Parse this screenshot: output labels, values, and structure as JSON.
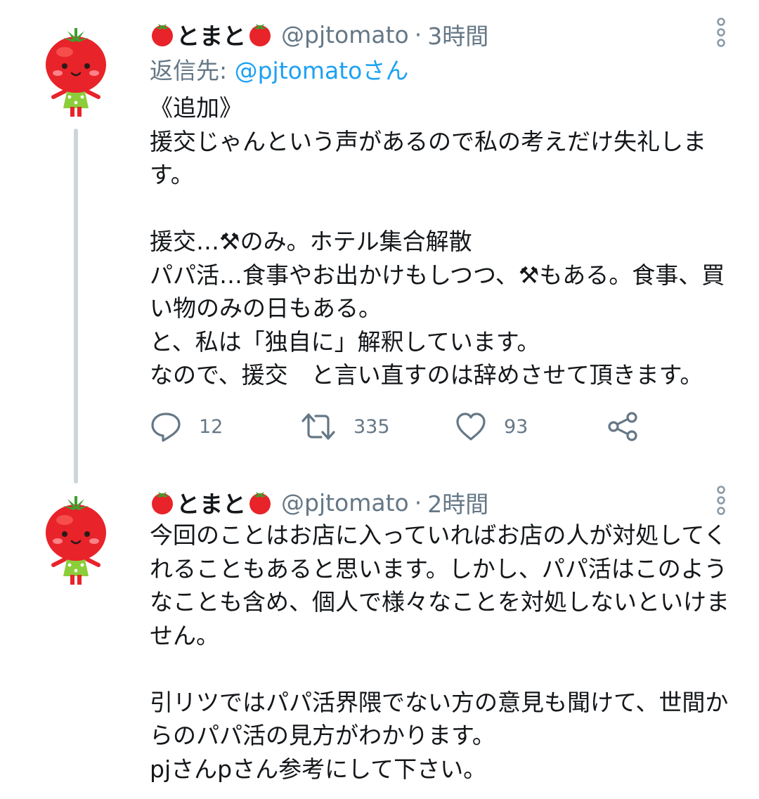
{
  "tweets": [
    {
      "display_name": "とまと",
      "handle": "@pjtomato",
      "separator": "·",
      "time": "3時間",
      "reply_prefix": "返信先: ",
      "reply_to": "@pjtomatoさん",
      "body": "《追加》\n援交じゃんという声があるので私の考えだけ失礼します。\n\n援交…⚒のみ。ホテル集合解散\nパパ活…食事やお出かけもしつつ、⚒もある。食事、買い物のみの日もある。\nと、私は「独自に」解釈しています。\nなので、援交　と言い直すのは辞めさせて頂きます。",
      "actions": {
        "reply_count": "12",
        "retweet_count": "335",
        "like_count": "93"
      }
    },
    {
      "display_name": "とまと",
      "handle": "@pjtomato",
      "separator": "·",
      "time": "2時間",
      "body": "今回のことはお店に入っていればお店の人が対処してくれることもあると思います。しかし、パパ活はこのようなことも含め、個人で様々なことを対処しないといけません。\n\n引リツではパパ活界隈でない方の意見も聞けて、世間からのパパ活の見方がわかります。\npjさんpさん参考にして下さい。"
    }
  ],
  "icons": {
    "name_emoji": "tomato-emoji",
    "reply": "speech-bubble-icon",
    "retweet": "retweet-icon",
    "like": "heart-icon",
    "share": "share-icon",
    "more": "vertical-dots-icon"
  },
  "colors": {
    "text": "#14171a",
    "secondary": "#657786",
    "link": "#1da1f2",
    "thread_line": "#cdd5dc",
    "tomato": "#e8232a"
  }
}
